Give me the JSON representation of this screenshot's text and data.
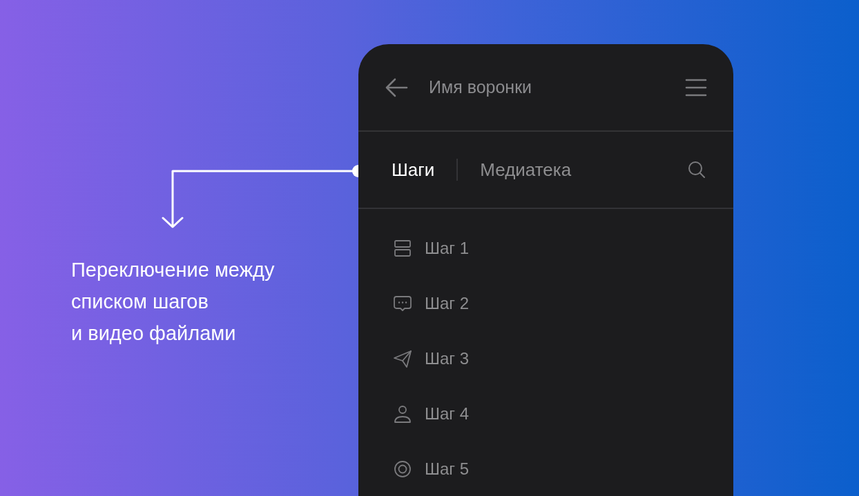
{
  "header": {
    "title": "Имя воронки"
  },
  "tabs": [
    {
      "label": "Шаги",
      "selected": true
    },
    {
      "label": "Медиатека",
      "selected": false
    }
  ],
  "steps": [
    {
      "label": "Шаг 1",
      "kind": "layout"
    },
    {
      "label": "Шаг 2",
      "kind": "message"
    },
    {
      "label": "Шаг 3",
      "kind": "send"
    },
    {
      "label": "Шаг 4",
      "kind": "user"
    },
    {
      "label": "Шаг 5",
      "kind": "target"
    }
  ],
  "callout": {
    "lines": [
      "Переключение между",
      "списком шагов",
      "и видео файлами"
    ]
  }
}
